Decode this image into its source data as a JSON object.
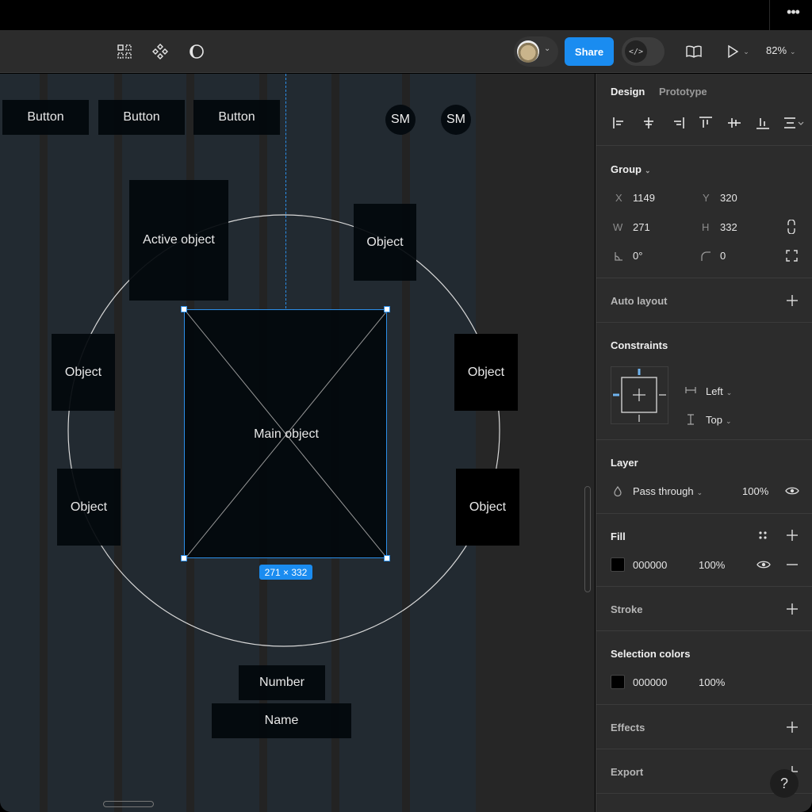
{
  "topbar": {
    "more_label": "•••"
  },
  "toolbar": {
    "left_icons": [
      "grid-component-icon",
      "components-icon",
      "contrast-theme-icon"
    ],
    "share_label": "Share",
    "devmode_label": "</>",
    "zoom_label": "82%",
    "colors": {
      "accent": "#1a8cf0"
    }
  },
  "canvas": {
    "buttons": [
      "Button",
      "Button",
      "Button"
    ],
    "avatars": [
      "SM",
      "SM"
    ],
    "active_object_label": "Active object",
    "objects": [
      "Object",
      "Object",
      "Object",
      "Object",
      "Object"
    ],
    "main_object_label": "Main object",
    "dimension_badge": "271 × 332",
    "number_label": "Number",
    "name_label": "Name"
  },
  "panel": {
    "tabs": [
      {
        "label": "Design",
        "active": true
      },
      {
        "label": "Prototype",
        "active": false
      }
    ],
    "group": {
      "title": "Group",
      "x_label": "X",
      "x_value": "1149",
      "y_label": "Y",
      "y_value": "320",
      "w_label": "W",
      "w_value": "271",
      "h_label": "H",
      "h_value": "332",
      "rotation_value": "0°",
      "radius_value": "0"
    },
    "auto_layout": {
      "title": "Auto layout"
    },
    "constraints": {
      "title": "Constraints",
      "horizontal": "Left",
      "vertical": "Top"
    },
    "layer": {
      "title": "Layer",
      "blend_mode": "Pass through",
      "opacity": "100%"
    },
    "fill": {
      "title": "Fill",
      "hex": "000000",
      "opacity": "100%",
      "color": "#000000"
    },
    "stroke": {
      "title": "Stroke"
    },
    "selection_colors": {
      "title": "Selection colors",
      "hex": "000000",
      "opacity": "100%"
    },
    "effects": {
      "title": "Effects"
    },
    "export": {
      "title": "Export"
    }
  },
  "help_label": "?"
}
